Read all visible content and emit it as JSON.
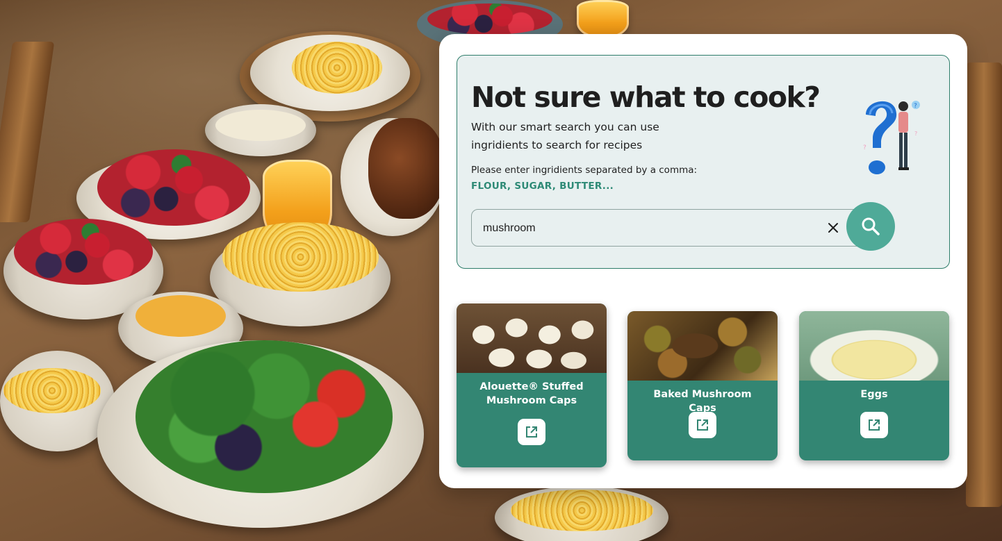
{
  "hero": {
    "title": "Not sure what to cook?",
    "subtitle": "With our smart search you can use ingridients to search for recipes",
    "instruction": "Please enter ingridients separated by a comma:",
    "example": "FLOUR, SUGAR, BUTTER..."
  },
  "search": {
    "value": "mushroom",
    "clear_icon": "close-icon",
    "button_icon": "search-icon"
  },
  "recipes": [
    {
      "title": "Alouette® Stuffed Mushroom Caps",
      "open_icon": "external-link-icon"
    },
    {
      "title": "Baked Mushroom Caps",
      "open_icon": "external-link-icon"
    },
    {
      "title": "Eggs",
      "open_icon": "external-link-icon"
    }
  ],
  "colors": {
    "accent": "#338673",
    "search_button": "#4faa98",
    "hero_bg": "#e8f0f0",
    "example_text": "#2e8a76"
  }
}
